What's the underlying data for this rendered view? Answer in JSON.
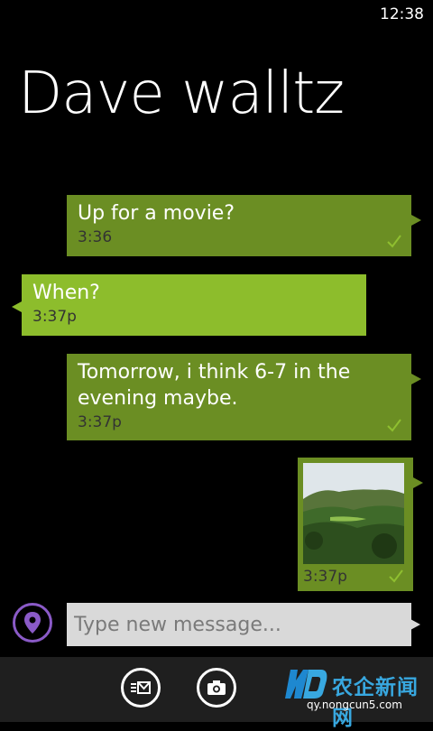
{
  "status_bar": {
    "time": "12:38"
  },
  "contact": {
    "name": "Dave walltz"
  },
  "messages": [
    {
      "direction": "outgoing",
      "text": "Up for a movie?",
      "time": "3:36"
    },
    {
      "direction": "incoming",
      "text": "When?",
      "time": "3:37p"
    },
    {
      "direction": "outgoing",
      "text": "Tomorrow, i think 6-7 in the evening maybe.",
      "time": "3:37p"
    },
    {
      "direction": "outgoing",
      "type": "photo",
      "time": "3:37p"
    }
  ],
  "composer": {
    "placeholder": "Type new message..."
  },
  "app_bar": {
    "buttons": [
      {
        "icon": "message-switch-icon"
      },
      {
        "icon": "camera-icon"
      }
    ]
  },
  "watermark": {
    "text": "农企新闻网",
    "url": "qy.nongcun5.com"
  },
  "colors": {
    "outgoing_bubble": "#6b8e23",
    "incoming_bubble": "#8dbd2c",
    "location_accent": "#8a5ac7"
  }
}
